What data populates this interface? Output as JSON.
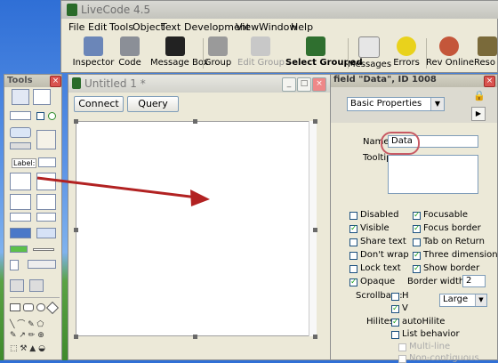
{
  "app": {
    "title": "LiveCode 4.5"
  },
  "menu": [
    "File",
    "Edit",
    "Tools",
    "Object",
    "Text",
    "Development",
    "View",
    "Window",
    "Help"
  ],
  "toolbar": [
    {
      "label": "Inspector",
      "icon": "inspector-icon"
    },
    {
      "label": "Code",
      "icon": "code-icon"
    },
    {
      "label": "Message Box",
      "icon": "message-box-icon"
    },
    {
      "label": "Group",
      "icon": "group-icon"
    },
    {
      "label": "Edit Group",
      "icon": "edit-group-icon"
    },
    {
      "label": "Select Grouped",
      "icon": "select-grouped-icon"
    },
    {
      "label": "Messages",
      "icon": "messages-icon"
    },
    {
      "label": "Errors",
      "icon": "errors-icon"
    },
    {
      "label": "Rev Online",
      "icon": "rev-online-icon"
    },
    {
      "label": "Reso",
      "icon": "resources-icon"
    }
  ],
  "tools": {
    "title": "Tools",
    "label_tool": "Label:"
  },
  "stack": {
    "title": "Untitled 1 *",
    "buttons": [
      "Connect",
      "Query"
    ]
  },
  "inspector": {
    "title": "field \"Data\", ID 1008",
    "pane": "Basic Properties",
    "name_label": "Name",
    "name_value": "Data",
    "tooltip_label": "Tooltip",
    "left_checks": [
      {
        "label": "Disabled",
        "checked": false
      },
      {
        "label": "Visible",
        "checked": true
      },
      {
        "label": "Share text",
        "checked": false
      },
      {
        "label": "Don't wrap",
        "checked": false
      },
      {
        "label": "Lock text",
        "checked": false
      },
      {
        "label": "Opaque",
        "checked": true
      }
    ],
    "right_checks": [
      {
        "label": "Focusable",
        "checked": true
      },
      {
        "label": "Focus border",
        "checked": true
      },
      {
        "label": "Tab on Return",
        "checked": false
      },
      {
        "label": "Three dimensional",
        "checked": true
      },
      {
        "label": "Show border",
        "checked": true
      }
    ],
    "border_width_label": "Border width",
    "border_width": "2",
    "scrollbars_label": "Scrollbars:",
    "h_label": "H",
    "v_label": "V",
    "scroll_size": "Large",
    "hilites_label": "Hilites:",
    "autohilite": "autoHilite",
    "list_behavior": "List behavior",
    "multiline": "Multi-line",
    "noncontiguous": "Non-contiguous"
  }
}
